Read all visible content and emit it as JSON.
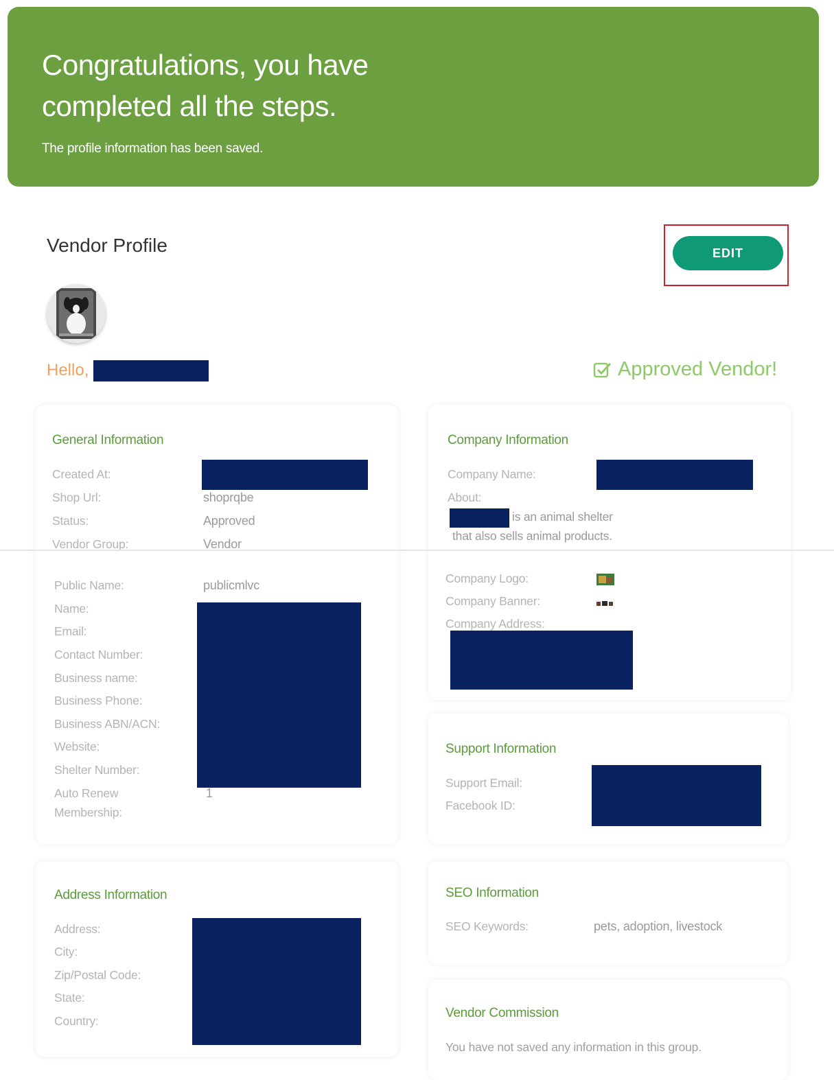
{
  "banner": {
    "title": "Congratulations, you have completed all the steps.",
    "subtitle": "The profile information has been saved."
  },
  "profile": {
    "title": "Vendor Profile",
    "edit_label": "EDIT",
    "hello": "Hello,",
    "status_badge": "Approved Vendor!"
  },
  "general": {
    "title": "General Information",
    "labels": {
      "created_at": "Created At:",
      "shop_url": "Shop Url:",
      "status": "Status:",
      "vendor_group": "Vendor Group:",
      "public_name": "Public Name:",
      "name": "Name:",
      "email": "Email:",
      "contact_number": "Contact Number:",
      "business_name": "Business name:",
      "business_phone": "Business Phone:",
      "business_abn": "Business ABN/ACN:",
      "website": "Website:",
      "shelter_number": "Shelter Number:",
      "auto_renew_1": "Auto Renew",
      "auto_renew_2": "Membership:"
    },
    "values": {
      "shop_url": "shoprqbe",
      "status": "Approved",
      "vendor_group": "Vendor",
      "public_name": "publicmlvc",
      "auto_renew": "1"
    }
  },
  "company": {
    "title": "Company Information",
    "labels": {
      "company_name": "Company Name:",
      "about": "About:",
      "company_logo": "Company Logo:",
      "company_banner": "Company Banner:",
      "company_address": "Company Address:"
    },
    "about_line1": "is an animal shelter",
    "about_line2": "that also sells animal products."
  },
  "support": {
    "title": "Support Information",
    "labels": {
      "support_email": "Support Email:",
      "facebook_id": "Facebook ID:"
    }
  },
  "address": {
    "title": "Address Information",
    "labels": {
      "address": "Address:",
      "city": "City:",
      "zip": "Zip/Postal Code:",
      "state": "State:",
      "country": "Country:"
    }
  },
  "seo": {
    "title": "SEO Information",
    "keywords_label": "SEO Keywords:",
    "keywords_value": "pets, adoption, livestock"
  },
  "commission": {
    "title": "Vendor Commission",
    "message": "You have not saved any information in this group."
  },
  "colors": {
    "banner": "#6b9f3f",
    "edit_button": "#0f9a75",
    "section_title": "#5b9c3a",
    "approved": "#8dc966",
    "hello": "#f0a060",
    "redaction": "#0a2260"
  }
}
